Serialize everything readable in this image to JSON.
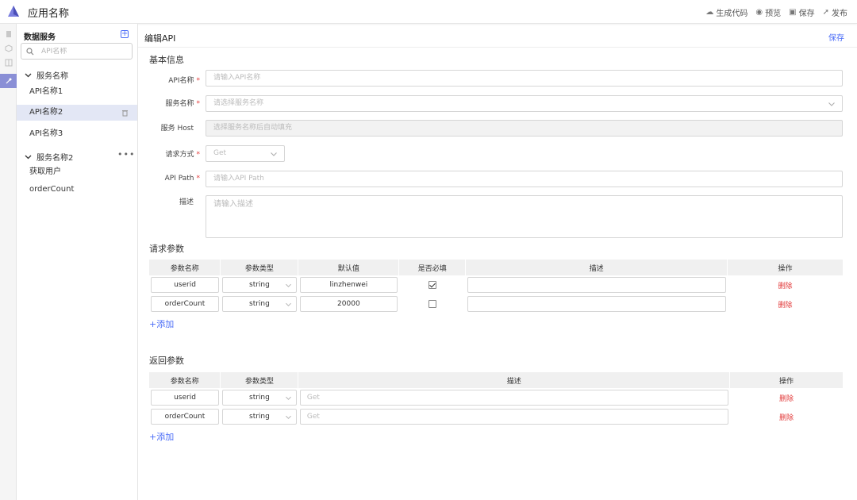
{
  "app": {
    "name": "应用名称"
  },
  "topbar": {
    "actions": [
      {
        "label": "生成代码",
        "icon": "cloud-icon"
      },
      {
        "label": "预览",
        "icon": "eye-icon"
      },
      {
        "label": "保存",
        "icon": "save-icon"
      },
      {
        "label": "发布",
        "icon": "send-icon"
      }
    ]
  },
  "sidebar": {
    "title": "数据服务",
    "search_placeholder": "API名称",
    "groups": [
      {
        "label": "服务名称",
        "items": [
          "API名称1",
          "API名称2",
          "API名称3"
        ],
        "selected": "API名称2"
      },
      {
        "label": "服务名称2",
        "items": [
          "获取用户",
          "orderCount"
        ]
      }
    ]
  },
  "main": {
    "title": "编辑API",
    "save_label": "保存",
    "basic_section": "基本信息",
    "fields": {
      "api_name": {
        "label": "API名称",
        "placeholder": "请输入API名称",
        "required": true
      },
      "service_name": {
        "label": "服务名称",
        "placeholder": "请选择服务名称",
        "required": true
      },
      "service_host": {
        "label": "服务 Host",
        "placeholder": "选择服务名称后自动填充",
        "required": false
      },
      "method": {
        "label": "请求方式",
        "value": "Get",
        "required": true
      },
      "api_path": {
        "label": "API Path",
        "placeholder": "请输入API Path",
        "required": true
      },
      "description": {
        "label": "描述",
        "placeholder": "请输入描述",
        "required": false
      }
    },
    "request_params": {
      "title": "请求参数",
      "headers": [
        "参数名称",
        "参数类型",
        "默认值",
        "是否必填",
        "描述",
        "操作"
      ],
      "rows": [
        {
          "name": "userid",
          "type": "string",
          "default": "linzhenwei",
          "required": true,
          "desc": "",
          "action": "删除"
        },
        {
          "name": "orderCount",
          "type": "string",
          "default": "20000",
          "required": false,
          "desc": "",
          "action": "删除"
        }
      ],
      "add_label": "+添加"
    },
    "response_params": {
      "title": "返回参数",
      "headers": [
        "参数名称",
        "参数类型",
        "描述",
        "操作"
      ],
      "rows": [
        {
          "name": "userid",
          "type": "string",
          "desc_placeholder": "Get",
          "action": "删除"
        },
        {
          "name": "orderCount",
          "type": "string",
          "desc_placeholder": "Get",
          "action": "删除"
        }
      ],
      "add_label": "+添加"
    }
  },
  "colors": {
    "accent": "#4a6cf7",
    "danger": "#e23b3b",
    "selected_bg": "#e3e7f5"
  }
}
